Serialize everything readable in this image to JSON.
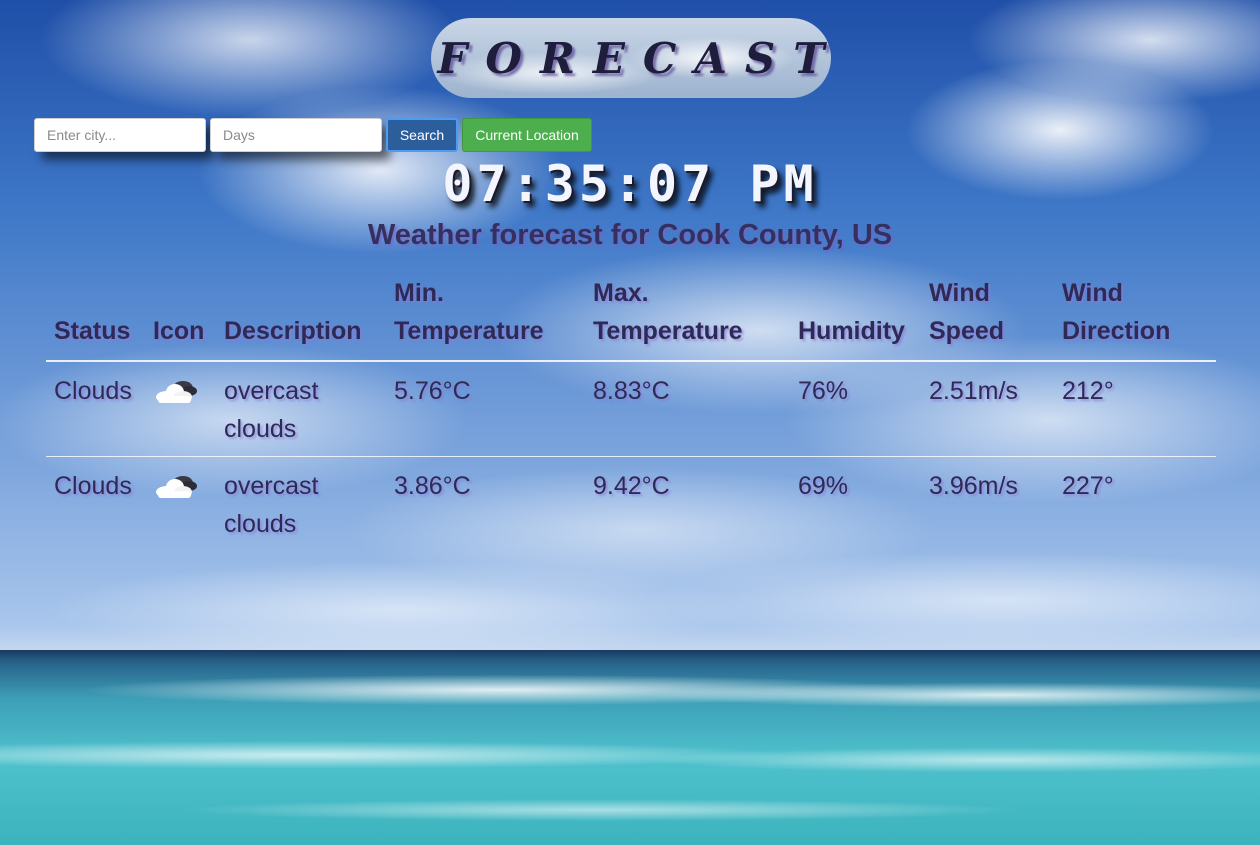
{
  "header": {
    "title": "FORECAST"
  },
  "search": {
    "city_placeholder": "Enter city...",
    "days_placeholder": "Days",
    "search_label": "Search",
    "location_label": "Current Location"
  },
  "clock": {
    "time": "07:35:07 PM"
  },
  "forecast": {
    "heading": "Weather forecast for Cook County, US",
    "columns": {
      "status": "Status",
      "icon": "Icon",
      "description": "Description",
      "min_temp_1": "Min.",
      "min_temp_2": "Temperature",
      "max_temp_1": "Max.",
      "max_temp_2": "Temperature",
      "humidity": "Humidity",
      "wind_speed_1": "Wind",
      "wind_speed_2": "Speed",
      "wind_dir_1": "Wind",
      "wind_dir_2": "Direction"
    },
    "rows": [
      {
        "status": "Clouds",
        "icon": "cloud-icon",
        "description_1": "overcast",
        "description_2": "clouds",
        "min_temp": "5.76°C",
        "max_temp": "8.83°C",
        "humidity": "76%",
        "wind_speed": "2.51m/s",
        "wind_direction": "212°"
      },
      {
        "status": "Clouds",
        "icon": "cloud-icon",
        "description_1": "overcast",
        "description_2": "clouds",
        "min_temp": "3.86°C",
        "max_temp": "9.42°C",
        "humidity": "69%",
        "wind_speed": "3.96m/s",
        "wind_direction": "227°"
      }
    ]
  },
  "colors": {
    "search_button": "#2d5e9c",
    "location_button": "#4cae4c",
    "heading_text": "#35305f"
  }
}
